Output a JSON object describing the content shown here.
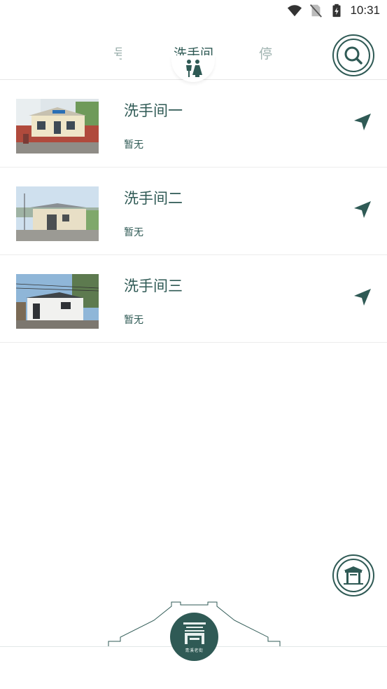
{
  "status_bar": {
    "time": "10:31"
  },
  "top_nav": {
    "tab_left": "号",
    "tab_active": "洗手间",
    "tab_right": "停"
  },
  "restrooms": [
    {
      "title": "洗手间一",
      "subtitle": "暂无"
    },
    {
      "title": "洗手间二",
      "subtitle": "暂无"
    },
    {
      "title": "洗手间三",
      "subtitle": "暂无"
    }
  ],
  "logo": {
    "caption": "青溪老街"
  },
  "colors": {
    "accent": "#2f5a55",
    "inactive_tab": "#9fb3b0",
    "divider": "#ececec"
  },
  "icons": [
    "wifi-icon",
    "no-sim-icon",
    "battery-charging-icon",
    "restroom-icon",
    "search-icon",
    "navigation-arrow-icon",
    "gate-icon",
    "logo-mark"
  ]
}
